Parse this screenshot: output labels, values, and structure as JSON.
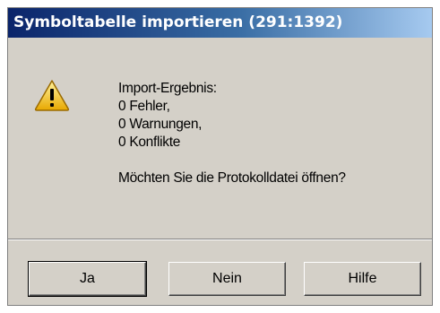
{
  "window": {
    "title": "Symboltabelle importieren (291:1392)"
  },
  "icon": {
    "name": "warning-icon",
    "color": "#f6c000"
  },
  "message": {
    "lines": [
      "Import-Ergebnis:",
      "0 Fehler,",
      "0 Warnungen,",
      "0 Konflikte"
    ],
    "question": "Möchten Sie die Protokolldatei öffnen?"
  },
  "buttons": {
    "yes": "Ja",
    "no": "Nein",
    "help": "Hilfe"
  }
}
